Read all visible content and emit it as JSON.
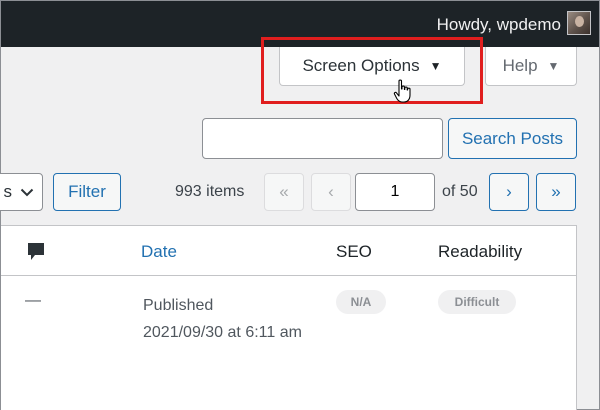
{
  "adminbar": {
    "greeting": "Howdy, wpdemo"
  },
  "screen_meta": {
    "screen_options_label": "Screen Options",
    "help_label": "Help"
  },
  "search": {
    "value": "",
    "button_label": "Search Posts"
  },
  "tablenav": {
    "bulk_select_partial": "s",
    "filter_label": "Filter",
    "items_count": "993 items",
    "first_page": "«",
    "prev_page": "‹",
    "current_page": "1",
    "of_total": "of 50",
    "next_page": "›",
    "last_page": "»"
  },
  "table": {
    "columns": {
      "date": "Date",
      "seo": "SEO",
      "readability": "Readability"
    },
    "rows": [
      {
        "comments": "—",
        "status": "Published",
        "datetime": "2021/09/30 at 6:11 am",
        "seo": "N/A",
        "readability": "Difficult"
      }
    ]
  },
  "colors": {
    "accent": "#2271b1",
    "adminbar": "#1d2327",
    "highlight": "#e01e1e"
  }
}
